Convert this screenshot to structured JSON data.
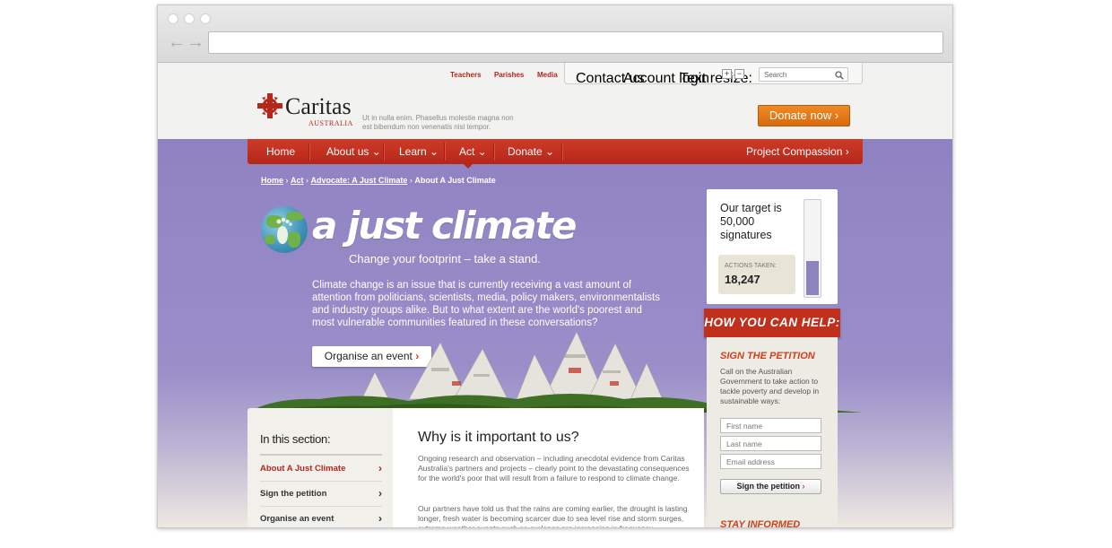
{
  "browser": {
    "url": ""
  },
  "utility": {
    "links": [
      "Teachers",
      "Parishes",
      "Media"
    ],
    "contact": "Contact us",
    "account": "Account login",
    "text_resize": "Text resize:",
    "plus": "+",
    "minus": "−",
    "search_placeholder": "Search"
  },
  "header": {
    "logo": "Caritas",
    "logo_sub": "AUSTRALIA",
    "tagline": "Ut in nulla enim. Phasellus molestie magna non est bibendum non venenatis nisl tempor.",
    "donate": "Donate now"
  },
  "nav": {
    "items": [
      "Home",
      "About us",
      "Learn",
      "Act",
      "Donate"
    ],
    "right": "Project Compassion"
  },
  "breadcrumb": [
    "Home",
    "Act",
    "Advocate: A Just Climate",
    "About A Just Climate"
  ],
  "hero": {
    "headline": "a just climate",
    "subhead": "Change your footprint – take a stand.",
    "intro": "Climate change is an issue that is currently receiving a vast amount of attention from politicians, scientists, media, policy makers, environmentalists and industry groups alike. But to what extent are the world's poorest and most vulnerable communities featured in these conversations?",
    "cta": "Organise an event"
  },
  "target": {
    "text": "Our target is 50,000 signatures",
    "actions_label": "ACTIONS TAKEN:",
    "actions_value": "18,247",
    "progress": 0.365
  },
  "help": {
    "title": "HOW YOU CAN HELP:",
    "petition_title": "SIGN THE PETITION",
    "petition_body": "Call on the Australian Government to take action to tackle poverty and develop in sustainable ways:",
    "first_name": "First name",
    "last_name": "Last name",
    "email": "Email address",
    "button": "Sign the petition",
    "stay": "STAY INFORMED"
  },
  "section": {
    "title": "In this section:",
    "items": [
      "About A Just Climate",
      "Sign the petition",
      "Organise an event"
    ]
  },
  "article": {
    "heading": "Why is it important to us?",
    "p1": "Ongoing research and observation – including anecdotal evidence from Caritas Australia's partners and projects – clearly point to the devastating consequences for the world's poor that will result from a failure to respond to climate change.",
    "p2": "Our partners have told us that the rains are coming earlier, the drought is lasting longer, fresh water is becoming scarcer due to sea level rise and storm surges, extreme weather events such as cyclones are increasing in frequency"
  },
  "colors": {
    "brand_red": "#c12f1d",
    "accent_orange": "#e67a1a",
    "hero_purple": "#8f83c1"
  }
}
